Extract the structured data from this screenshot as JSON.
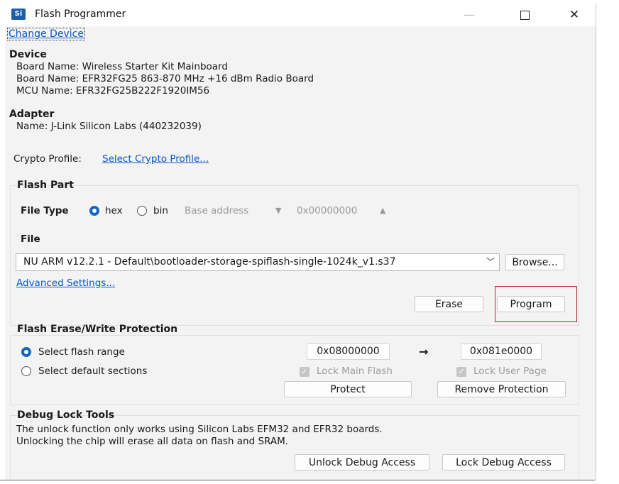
{
  "window": {
    "app_logo": "Si",
    "title": "Flash Programmer",
    "minimize": "—",
    "close": "✕"
  },
  "change_device": "Change Device",
  "device": {
    "heading": "Device",
    "board1": "Board Name: Wireless Starter Kit Mainboard",
    "board2": "Board Name: EFR32FG25 863-870 MHz +16 dBm Radio Board",
    "mcu": "MCU Name: EFR32FG25B222F1920IM56"
  },
  "adapter": {
    "heading": "Adapter",
    "name": "Name: J-Link Silicon Labs (440232039)"
  },
  "crypto": {
    "label": "Crypto Profile:",
    "link": "Select Crypto Profile..."
  },
  "flash_part": {
    "heading": "Flash Part",
    "file_type_label": "File Type",
    "hex_label": "hex",
    "bin_label": "bin",
    "hex_selected": true,
    "base_address_label": "Base address",
    "base_address_value": "0x00000000",
    "file_label": "File",
    "file_value": "NU ARM v12.2.1 - Default\\bootloader-storage-spiflash-single-1024k_v1.s37",
    "browse": "Browse...",
    "advanced": "Advanced Settings...",
    "erase": "Erase",
    "program": "Program"
  },
  "protection": {
    "heading": "Flash Erase/Write Protection",
    "range_label": "Select flash range",
    "default_label": "Select default sections",
    "range_selected": true,
    "start": "0x08000000",
    "arrow": "→",
    "end": "0x081e0000",
    "lock_main": "Lock Main Flash",
    "lock_user": "Lock User Page",
    "protect": "Protect",
    "remove": "Remove Protection"
  },
  "debug": {
    "heading": "Debug Lock Tools",
    "line1": "The unlock function only works using Silicon Labs EFM32 and EFR32 boards.",
    "line2": "Unlocking the chip will erase all data on flash and SRAM.",
    "unlock": "Unlock Debug Access",
    "lock": "Lock Debug Access"
  }
}
